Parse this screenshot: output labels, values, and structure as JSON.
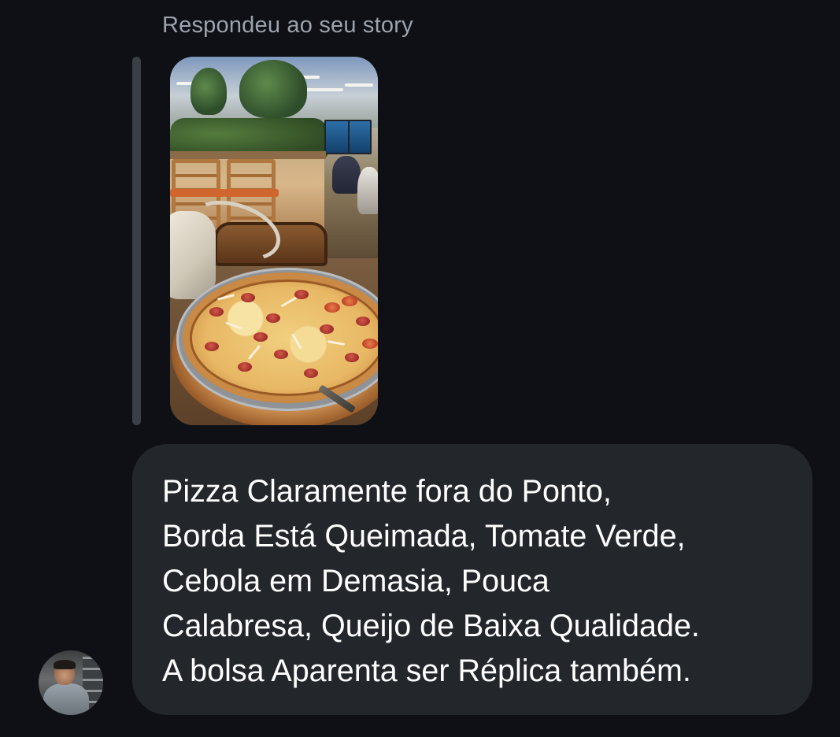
{
  "reply_header": "Respondeu ao seu story",
  "story": {
    "thumbnail_icon": "pizza-photo-image"
  },
  "message": {
    "lines": [
      "Pizza Claramente fora do Ponto,",
      "Borda Está Queimada, Tomate Verde,",
      "Cebola em Demasia, Pouca",
      "Calabresa, Queijo de Baixa Qualidade.",
      "A bolsa Aparenta ser Réplica também."
    ]
  },
  "sender": {
    "avatar_icon": "user-avatar-photo"
  },
  "colors": {
    "background": "#0e1015",
    "bubble": "#23262b",
    "reply_header_text": "#9da3ad",
    "quote_bar": "#3a3e45",
    "message_text": "#ffffff"
  }
}
